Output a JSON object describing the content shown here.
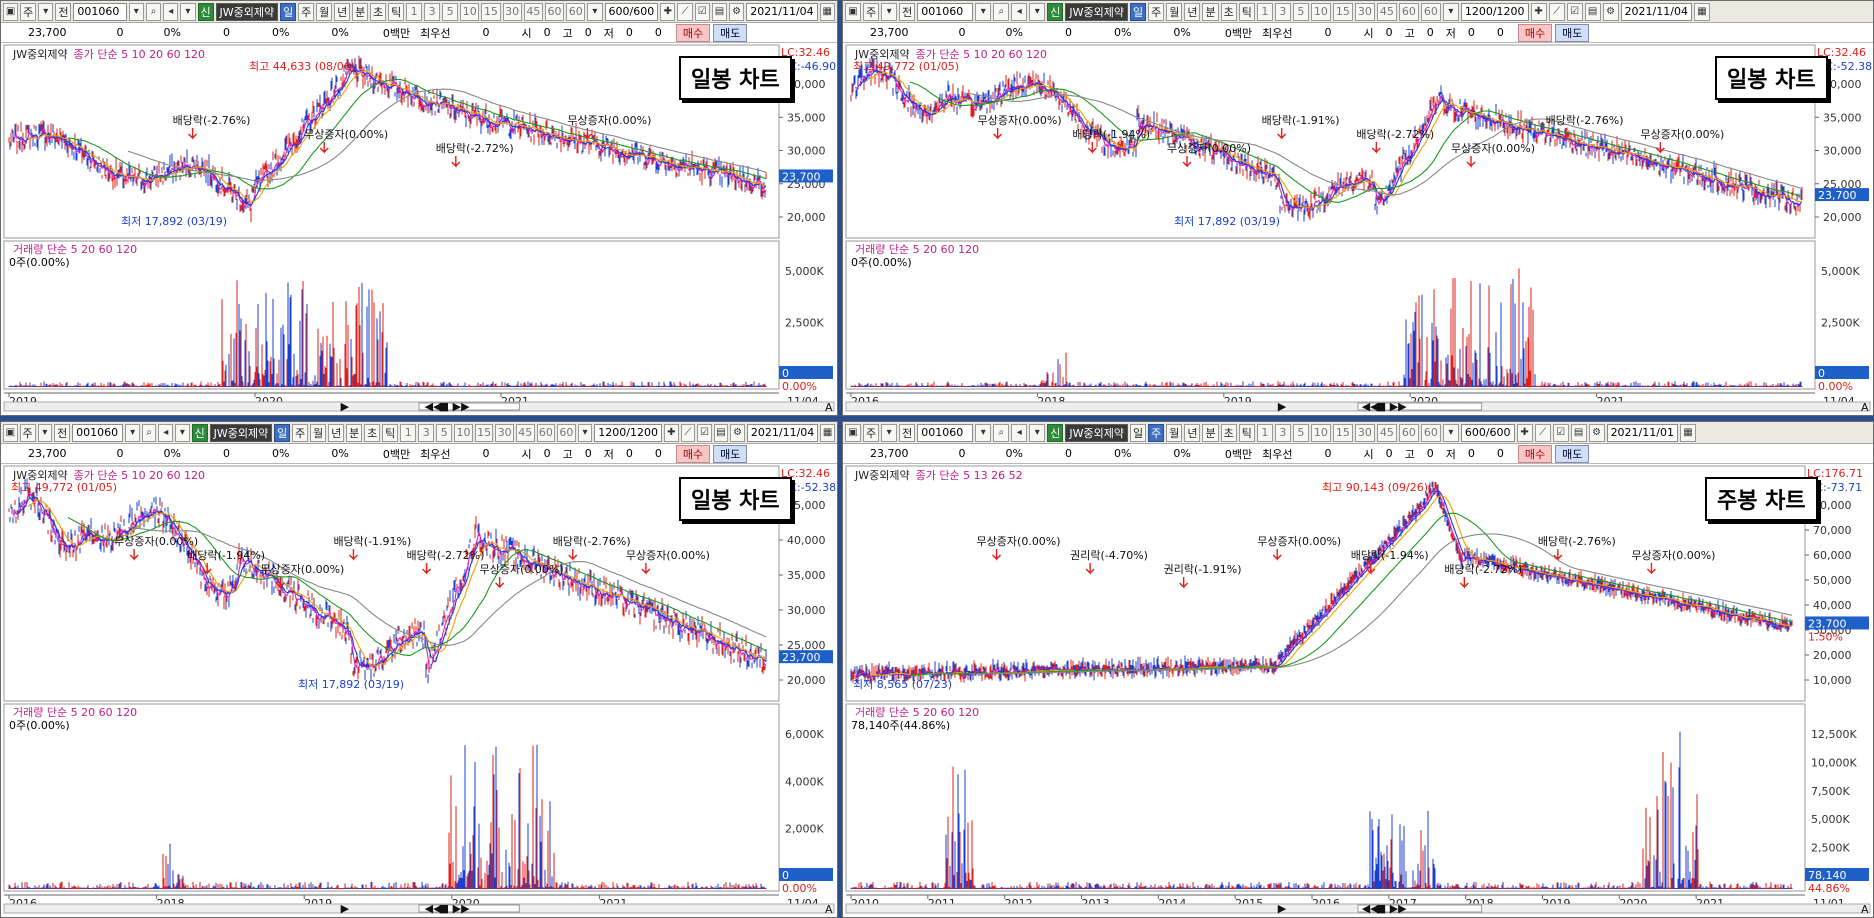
{
  "stock": {
    "code": "001060",
    "name": "JW중외제약",
    "market_badge": "신",
    "price": "23,700",
    "change": "0",
    "pct": "0%",
    "vol": "0",
    "vol_pct": "0%",
    "val_pct": "0%",
    "amount": "0백만",
    "ask_label": "최우선",
    "ask": "0",
    "open_label": "시",
    "open": "0",
    "high_label": "고",
    "high": "0",
    "low_label": "저",
    "low": "0",
    "buy": "매수",
    "sell": "매도",
    "zero": "0"
  },
  "toolbar": {
    "menu1": "주",
    "menu2": "전",
    "periods": [
      "일",
      "주",
      "월",
      "년",
      "분",
      "초",
      "틱"
    ],
    "mins": [
      "1",
      "3",
      "5",
      "10",
      "15",
      "30",
      "45",
      "60",
      "60"
    ]
  },
  "panels": [
    {
      "id": "p1",
      "count": "600/600",
      "date": "2021/11/04",
      "stamp": "일봉 차트",
      "legend": "종가 단순 5 10 20 60 120",
      "lc": "LC:32.46",
      "hc": "HC:-46.90",
      "price_ticks": [
        "40,000",
        "35,000",
        "30,000",
        "25,000",
        "20,000"
      ],
      "price_tag": "23,700",
      "vol_legend": "거래량 단순 5 20 60 120",
      "vol_info": "0주(0.00%)",
      "vol_ticks": [
        "5,000K",
        "2,500K"
      ],
      "vol_tag": "0",
      "vol_pct_tag": "0.00%",
      "x_ticks": [
        "2019",
        "2020",
        "2021",
        "11/04"
      ],
      "hi_label": "최고 44,633 (08/06)",
      "lo_label": "최저 17,892 (03/19)",
      "events": [
        "배당락(-2.76%)",
        "무상증자(0.00%)",
        "배당락(-2.72%)",
        "무상증자(0.00%)"
      ]
    },
    {
      "id": "p2",
      "count": "1200/1200",
      "date": "2021/11/04",
      "stamp": "일봉 차트",
      "legend": "종가 단순 5 10 20 60 120",
      "lc": "LC:32.46",
      "hc": "HC:-52.38",
      "price_ticks": [
        "40,000",
        "35,000",
        "30,000",
        "25,000",
        "20,000"
      ],
      "price_tag": "23,700",
      "vol_legend": "거래량 단순 5 20 60 120",
      "vol_info": "0주(0.00%)",
      "vol_ticks": [
        "5,000K",
        "2,500K"
      ],
      "vol_tag": "0",
      "vol_pct_tag": "0.00%",
      "x_ticks": [
        "2016",
        "2018",
        "2019",
        "2020",
        "2021",
        "11/04"
      ],
      "hi_label": "최고 49,772 (01/05)",
      "lo_label": "최저 17,892 (03/19)",
      "events": [
        "무상증자(0.00%)",
        "배당락(-1.94%)",
        "무상증자(0.00%)",
        "배당락(-1.91%)",
        "배당락(-2.72%)",
        "무상증자(0.00%)",
        "배당락(-2.76%)",
        "무상증자(0.00%)"
      ]
    },
    {
      "id": "p3",
      "count": "1200/1200",
      "date": "2021/11/04",
      "stamp": "일봉 차트",
      "legend": "종가 단순 5 10 20 60 120",
      "lc": "LC:32.46",
      "hc": "HC:-52.38",
      "price_ticks": [
        "45,000",
        "40,000",
        "35,000",
        "30,000",
        "25,000",
        "20,000"
      ],
      "price_tag": "23,700",
      "vol_legend": "거래량 단순 5 20 60 120",
      "vol_info": "0주(0.00%)",
      "vol_ticks": [
        "6,000K",
        "4,000K",
        "2,000K"
      ],
      "vol_tag": "0",
      "vol_pct_tag": "0.00%",
      "x_ticks": [
        "2016",
        "2018",
        "2019",
        "2020",
        "2021",
        "11/04"
      ],
      "hi_label": "최고 49,772 (01/05)",
      "lo_label": "최저 17,892 (03/19)",
      "events": [
        "무상증자(0.00%)",
        "배당락(-1.94%)",
        "무상증자(0.00%)",
        "배당락(-1.91%)",
        "배당락(-2.72%)",
        "무상증자(0.00%)",
        "배당락(-2.76%)",
        "무상증자(0.00%)"
      ]
    },
    {
      "id": "p4",
      "count": "600/600",
      "date": "2021/11/01",
      "stamp": "주봉 차트",
      "legend": "종가 단순 5 13 26 52",
      "lc": "LC:176.71",
      "hc": "HC:-73.71",
      "price_ticks": [
        "80,000",
        "70,000",
        "60,000",
        "50,000",
        "40,000",
        "30,000",
        "20,000",
        "10,000"
      ],
      "price_tag": "23,700",
      "price_pct_tag": "1.50%",
      "vol_legend": "거래량 단순 5 20 60 120",
      "vol_info": "78,140주(44.86%)",
      "vol_ticks": [
        "12,500K",
        "10,000K",
        "7,500K",
        "5,000K",
        "2,500K"
      ],
      "vol_tag": "78,140",
      "vol_pct_tag": "44.86%",
      "x_ticks": [
        "2010",
        "2011",
        "2012",
        "2013",
        "2014",
        "2015",
        "2016",
        "2017",
        "2018",
        "2019",
        "2020",
        "2021",
        "11/01"
      ],
      "hi_label": "최고 90,143 (09/26)",
      "lo_label": "최저 8,565 (07/23)",
      "events": [
        "무상증자(0.00%)",
        "권리락(-4.70%)",
        "권리락(-1.91%)",
        "무상증자(0.00%)",
        "배당락(-1.94%)",
        "배당락(-2.72%)",
        "배당락(-2.76%)",
        "무상증자(0.00%)"
      ]
    }
  ],
  "colors": {
    "up": "#e0201a",
    "down": "#1a3fd0",
    "ma5": "#e020c0",
    "ma10": "#1a3fd0",
    "ma20": "#f0a000",
    "ma60": "#1a9a20",
    "ma120": "#888888",
    "tag": "#1f5fc8",
    "splitter": "#2c4d8c"
  },
  "scrollbar": {
    "a_label": "A"
  }
}
